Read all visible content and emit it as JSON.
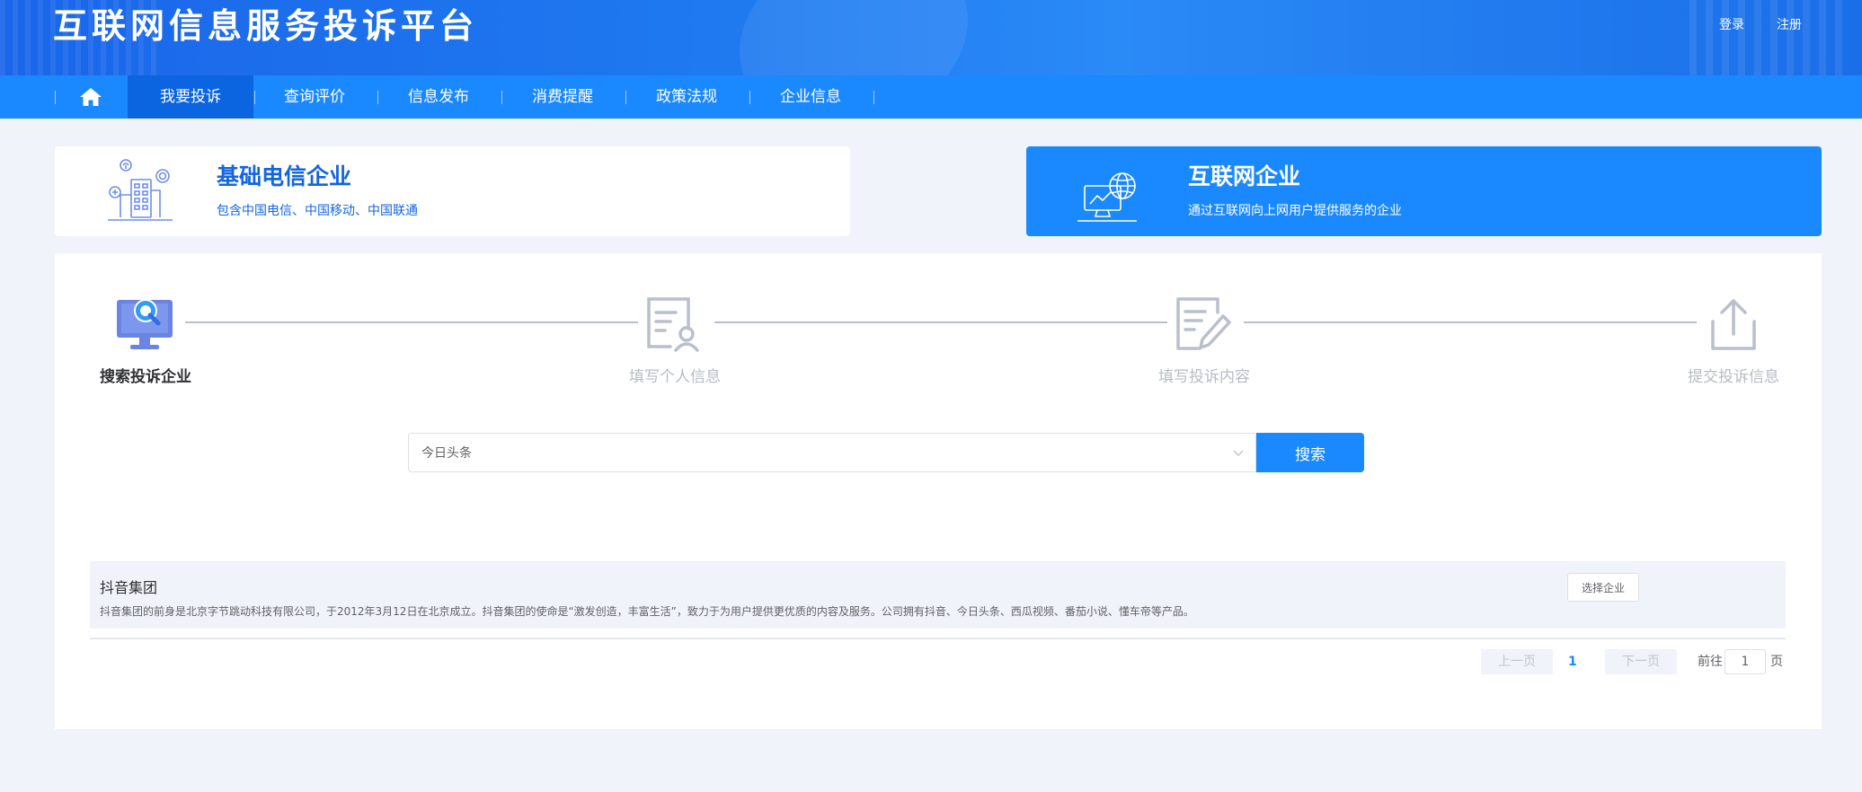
{
  "header": {
    "title": "互联网信息服务投诉平台",
    "login": "登录",
    "register": "注册"
  },
  "nav": {
    "home_icon": "home-icon",
    "items": [
      {
        "label": "我要投诉",
        "active": true
      },
      {
        "label": "查询评价",
        "active": false
      },
      {
        "label": "信息发布",
        "active": false
      },
      {
        "label": "消费提醒",
        "active": false
      },
      {
        "label": "政策法规",
        "active": false
      },
      {
        "label": "企业信息",
        "active": false
      }
    ]
  },
  "categories": [
    {
      "title": "基础电信企业",
      "desc": "包含中国电信、中国移动、中国联通",
      "icon": "telecom-building-icon",
      "selected": false
    },
    {
      "title": "互联网企业",
      "desc": "通过互联网向上网用户提供服务的企业",
      "icon": "internet-monitor-globe-icon",
      "selected": true
    }
  ],
  "steps": [
    {
      "label": "搜索投诉企业",
      "icon": "search-monitor-icon",
      "active": true
    },
    {
      "label": "填写个人信息",
      "icon": "personal-info-icon",
      "active": false
    },
    {
      "label": "填写投诉内容",
      "icon": "edit-document-icon",
      "active": false
    },
    {
      "label": "提交投诉信息",
      "icon": "upload-icon",
      "active": false
    }
  ],
  "search": {
    "value": "今日头条",
    "button": "搜索"
  },
  "results": [
    {
      "name": "抖音集团",
      "desc": "抖音集团的前身是北京字节跳动科技有限公司，于2012年3月12日在北京成立。抖音集团的使命是“激发创造，丰富生活”，致力于为用户提供更优质的内容及服务。公司拥有抖音、今日头条、西瓜视频、番茄小说、懂车帝等产品。",
      "select_label": "选择企业"
    }
  ],
  "pagination": {
    "prev": "上一页",
    "current": "1",
    "next": "下一页",
    "goto_prefix": "前往",
    "goto_value": "1",
    "goto_suffix": "页"
  },
  "colors": {
    "primary": "#1a88fe",
    "nav_active": "#0b64e0",
    "banner": "#1f7af0",
    "background": "#f0f3f9"
  }
}
